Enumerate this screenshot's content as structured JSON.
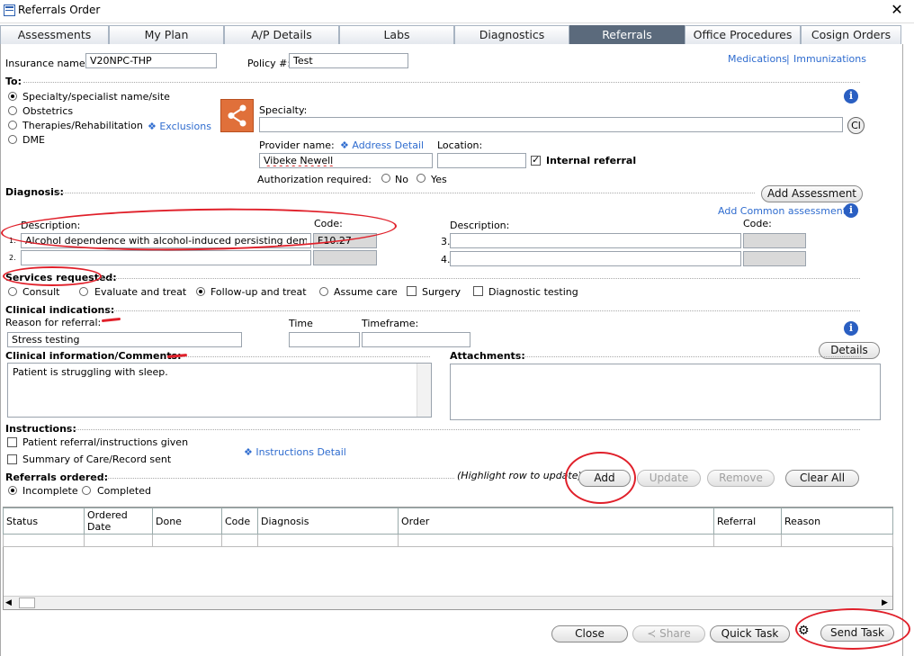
{
  "window": {
    "title": "Referrals Order",
    "close_glyph": "✕"
  },
  "tabs": [
    "Assessments",
    "My Plan",
    "A/P Details",
    "Labs",
    "Diagnostics",
    "Referrals",
    "Office Procedures",
    "Cosign Orders"
  ],
  "active_tab": "Referrals",
  "insurance": {
    "label": "Insurance name:",
    "value": "V20NPC-THP"
  },
  "policy": {
    "label": "Policy #:",
    "value": "Test"
  },
  "top_links": {
    "medications": "Medications",
    "sep": "|",
    "immunizations": "Immunizations"
  },
  "to": {
    "label": "To:",
    "options": [
      "Specialty/specialist name/site",
      "Obstetrics",
      "Therapies/Rehabilitation",
      "DME"
    ],
    "selected": "Specialty/specialist name/site",
    "exclusions": "Exclusions"
  },
  "specialty": {
    "label": "Specialty:",
    "value": "",
    "clear_btn": "Cl"
  },
  "provider": {
    "label": "Provider name:",
    "value": "Vibeke Newell",
    "address_detail": "Address Detail"
  },
  "location": {
    "label": "Location:",
    "value": ""
  },
  "internal_referral": {
    "label": "Internal referral",
    "checked": true
  },
  "authorization": {
    "label": "Authorization required:",
    "options": [
      "No",
      "Yes"
    ]
  },
  "diagnosis": {
    "label": "Diagnosis:",
    "add_assessment": "Add Assessment",
    "add_common": "Add Common assessment",
    "desc_label": "Description:",
    "code_label": "Code:",
    "rows": [
      {
        "num": "1.",
        "description": "Alcohol dependence with alcohol-induced persisting dementia",
        "code": "F10.27"
      },
      {
        "num": "2.",
        "description": "",
        "code": ""
      },
      {
        "num": "3.",
        "description": "",
        "code": ""
      },
      {
        "num": "4.",
        "description": "",
        "code": ""
      }
    ]
  },
  "services": {
    "label": "Services requested:",
    "radios": [
      "Consult",
      "Evaluate and treat",
      "Follow-up and treat",
      "Assume care"
    ],
    "selected": "Follow-up and treat",
    "checks": [
      "Surgery",
      "Diagnostic testing"
    ]
  },
  "clinical": {
    "label": "Clinical indications:",
    "reason_label": "Reason for referral:",
    "reason_value": "Stress testing",
    "time_label": "Time",
    "timeframe_label": "Timeframe:",
    "details_btn": "Details",
    "comments_label": "Clinical information/Comments:",
    "comments_value": "Patient is struggling with sleep.",
    "attachments_label": "Attachments:"
  },
  "instructions": {
    "label": "Instructions:",
    "items": [
      "Patient referral/instructions given",
      "Summary of Care/Record sent"
    ],
    "detail_link": "Instructions Detail"
  },
  "referrals_ordered": {
    "label": "Referrals ordered:",
    "options": [
      "Incomplete",
      "Completed"
    ],
    "selected": "Incomplete",
    "hint": "(Highlight row to update)",
    "add": "Add",
    "update": "Update",
    "remove": "Remove",
    "clear_all": "Clear All"
  },
  "table": {
    "columns": [
      "Status",
      "Ordered Date",
      "Done",
      "Code",
      "Diagnosis",
      "Order",
      "Referral",
      "Reason"
    ]
  },
  "footer": {
    "close": "Close",
    "share": "Share",
    "quick_task": "Quick Task",
    "send_task": "Send Task"
  },
  "colors": {
    "accent": "#2f6ccf",
    "active_tab": "#5b6a7c",
    "annotation": "#e0202a",
    "share_icon_bg": "#e0703a"
  }
}
